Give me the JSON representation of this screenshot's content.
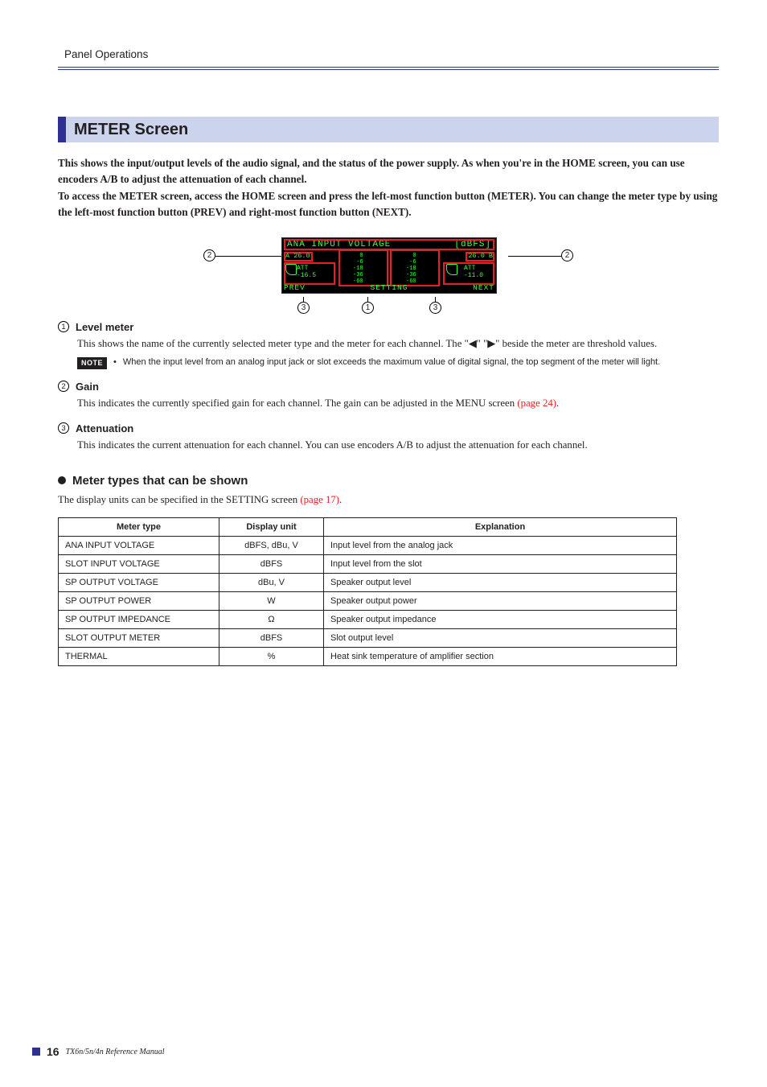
{
  "runningHead": "Panel Operations",
  "sectionTitle": "METER Screen",
  "intro": "This shows the input/output levels of the audio signal, and the status of the power supply. As when you're in the HOME screen, you can use encoders A/B to adjust the attenuation of each channel.\nTo access the METER screen, access the HOME screen and press the left-most function button (METER). You can change the meter type by using the left-most function button (PREV) and right-most function button (NEXT).",
  "screen": {
    "title": "ANA INPUT VOLTAGE",
    "unit": "[dBFS]",
    "gainA": "A 26.0",
    "gainB": "26.0 B",
    "attA_label": "ATT",
    "attA_val": "-16.5",
    "attB_label": "ATT",
    "attB_val": "-11.0",
    "scale": "0\n-6\n-18\n-36\n-60",
    "softkeys": {
      "prev": "PREV",
      "setting": "SETTING",
      "next": "NEXT"
    }
  },
  "callouts": {
    "one": "1",
    "two": "2",
    "three": "3"
  },
  "items": [
    {
      "num": "1",
      "title": "Level meter",
      "body": "This shows the name of the currently selected meter type and the meter for each channel. The \"◀\" \"▶\" beside the meter are threshold values.",
      "note": "When the input level from an analog input jack or slot exceeds the maximum value of digital signal, the top segment of the meter will light."
    },
    {
      "num": "2",
      "title": "Gain",
      "body_pre": "This indicates the currently specified gain for each channel. The gain can be adjusted in the MENU screen ",
      "body_link": "(page 24)",
      "body_post": "."
    },
    {
      "num": "3",
      "title": "Attenuation",
      "body": "This indicates the current attenuation for each channel. You can use encoders A/B to adjust the attenuation for each channel."
    }
  ],
  "noteLabel": "NOTE",
  "subhead": "Meter types that can be shown",
  "subintro_pre": "The display units can be specified in the SETTING screen ",
  "subintro_link": "(page 17)",
  "subintro_post": ".",
  "tableHeaders": {
    "type": "Meter type",
    "unit": "Display unit",
    "expl": "Explanation"
  },
  "chart_data": {
    "type": "table",
    "columns": [
      "Meter type",
      "Display unit",
      "Explanation"
    ],
    "rows": [
      [
        "ANA INPUT VOLTAGE",
        "dBFS, dBu, V",
        "Input level from the analog jack"
      ],
      [
        "SLOT INPUT VOLTAGE",
        "dBFS",
        "Input level from the slot"
      ],
      [
        "SP OUTPUT VOLTAGE",
        "dBu, V",
        "Speaker output level"
      ],
      [
        "SP OUTPUT POWER",
        "W",
        "Speaker output power"
      ],
      [
        "SP OUTPUT IMPEDANCE",
        "Ω",
        "Speaker output impedance"
      ],
      [
        "SLOT OUTPUT METER",
        "dBFS",
        "Slot output level"
      ],
      [
        "THERMAL",
        "%",
        "Heat sink temperature of amplifier section"
      ]
    ]
  },
  "footer": {
    "page": "16",
    "doc": "TX6n/5n/4n  Reference Manual"
  }
}
